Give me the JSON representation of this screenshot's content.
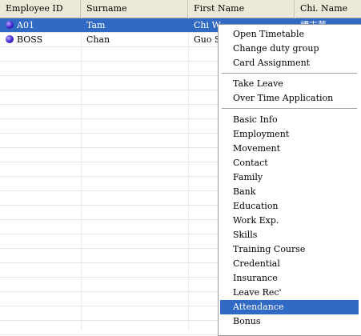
{
  "columns": [
    "Employee ID",
    "Surname",
    "First Name",
    "Chi. Name"
  ],
  "rows": [
    {
      "id": "A01",
      "surname": "Tam",
      "first_name": "Chi W",
      "chi_name": "譚志華",
      "selected": true
    },
    {
      "id": "BOSS",
      "surname": "Chan",
      "first_name": "Guo S",
      "chi_name": "",
      "selected": false
    }
  ],
  "context_menu": {
    "groups": [
      [
        "Open Timetable",
        "Change duty group",
        "Card Assignment"
      ],
      [
        "Take Leave",
        "Over Time Application"
      ],
      [
        "Basic Info",
        "Employment",
        "Movement",
        "Contact",
        "Family",
        "Bank",
        "Education",
        "Work Exp.",
        "Skills",
        "Training Course",
        "Credential",
        "Insurance",
        "Leave Rec'",
        "Attendance",
        "Bonus"
      ]
    ],
    "highlighted": "Attendance"
  },
  "colors": {
    "selection": "#316ac5",
    "header_bg": "#ece9d8"
  }
}
